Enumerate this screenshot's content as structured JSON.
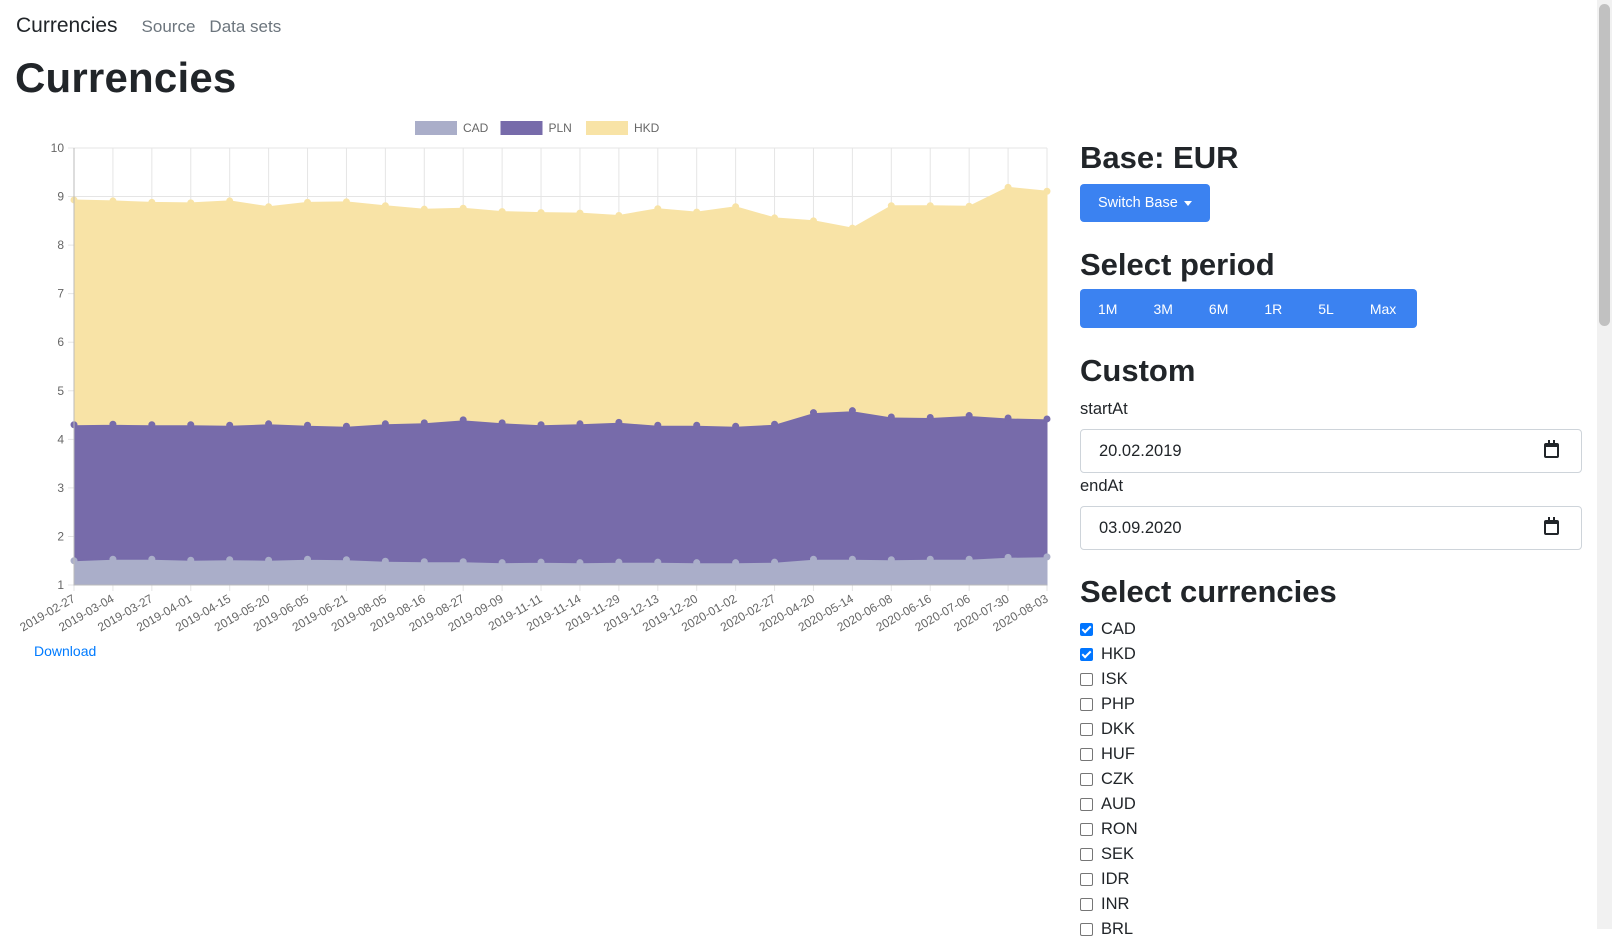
{
  "nav": {
    "brand": "Currencies",
    "links": [
      "Source",
      "Data sets"
    ]
  },
  "page_title": "Currencies",
  "download_label": "Download",
  "sidebar": {
    "base_heading": "Base: EUR",
    "switch_base_label": "Switch Base",
    "period_heading": "Select period",
    "periods": [
      "1M",
      "3M",
      "6M",
      "1R",
      "5L",
      "Max"
    ],
    "custom_heading": "Custom",
    "start_label": "startAt",
    "start_value": "20.02.2019",
    "end_label": "endAt",
    "end_value": "03.09.2020",
    "currencies_heading": "Select currencies",
    "currencies": [
      {
        "code": "CAD",
        "checked": true
      },
      {
        "code": "HKD",
        "checked": true
      },
      {
        "code": "ISK",
        "checked": false
      },
      {
        "code": "PHP",
        "checked": false
      },
      {
        "code": "DKK",
        "checked": false
      },
      {
        "code": "HUF",
        "checked": false
      },
      {
        "code": "CZK",
        "checked": false
      },
      {
        "code": "AUD",
        "checked": false
      },
      {
        "code": "RON",
        "checked": false
      },
      {
        "code": "SEK",
        "checked": false
      },
      {
        "code": "IDR",
        "checked": false
      },
      {
        "code": "INR",
        "checked": false
      },
      {
        "code": "BRL",
        "checked": false
      }
    ]
  },
  "colors": {
    "primary": "#3b82f1",
    "cad": "#aaaec9",
    "pln": "#776baa",
    "hkd": "#f8e3a6"
  },
  "chart_data": {
    "type": "area",
    "stacked": true,
    "x": [
      "2019-02-27",
      "2019-03-04",
      "2019-03-27",
      "2019-04-01",
      "2019-04-15",
      "2019-05-20",
      "2019-06-05",
      "2019-06-21",
      "2019-08-05",
      "2019-08-16",
      "2019-08-27",
      "2019-09-09",
      "2019-11-11",
      "2019-11-14",
      "2019-11-29",
      "2019-12-13",
      "2019-12-20",
      "2020-01-02",
      "2020-02-27",
      "2020-04-20",
      "2020-05-14",
      "2020-06-08",
      "2020-06-16",
      "2020-07-06",
      "2020-07-30",
      "2020-08-03"
    ],
    "series": [
      {
        "name": "CAD",
        "color": "#aaaec9",
        "values": [
          1.5,
          1.53,
          1.53,
          1.51,
          1.52,
          1.51,
          1.53,
          1.52,
          1.49,
          1.48,
          1.48,
          1.46,
          1.47,
          1.46,
          1.47,
          1.47,
          1.46,
          1.46,
          1.47,
          1.53,
          1.53,
          1.52,
          1.53,
          1.53,
          1.57,
          1.58
        ]
      },
      {
        "name": "PLN",
        "color": "#776baa",
        "values": [
          2.8,
          2.78,
          2.77,
          2.79,
          2.77,
          2.81,
          2.76,
          2.75,
          2.83,
          2.86,
          2.92,
          2.88,
          2.83,
          2.86,
          2.88,
          2.82,
          2.83,
          2.81,
          2.84,
          3.02,
          3.06,
          2.94,
          2.92,
          2.96,
          2.87,
          2.84
        ]
      },
      {
        "name": "HKD",
        "color": "#f8e3a6",
        "values": [
          4.63,
          4.6,
          4.58,
          4.57,
          4.62,
          4.47,
          4.59,
          4.62,
          4.49,
          4.4,
          4.36,
          4.35,
          4.37,
          4.34,
          4.26,
          4.46,
          4.39,
          4.52,
          4.25,
          3.95,
          3.76,
          4.35,
          4.36,
          4.31,
          4.75,
          4.69
        ]
      }
    ],
    "ylim": [
      1,
      10
    ],
    "yticks": [
      1,
      2,
      3,
      4,
      5,
      6,
      7,
      8,
      9,
      10
    ],
    "grid": true,
    "legend_position": "top"
  }
}
